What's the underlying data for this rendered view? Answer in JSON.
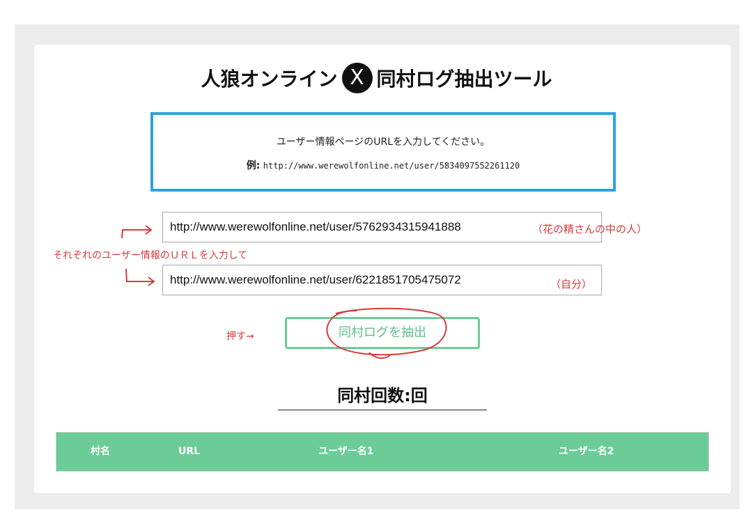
{
  "header": {
    "title_left": "人狼オンライン",
    "title_badge": "X",
    "title_right": "同村ログ抽出ツール"
  },
  "info": {
    "instruction": "ユーザー情報ページのURLを入力してください。",
    "example_label": "例:",
    "example_url": "http://www.werewolfonline.net/user/5834097552261120"
  },
  "form": {
    "url1_value": "http://www.werewolfonline.net/user/5762934315941888",
    "url2_value": "http://www.werewolfonline.net/user/6221851705475072",
    "extract_button_label": "同村ログを抽出"
  },
  "annotations": {
    "note1": "（花の精さんの中の人）",
    "note2": "（自分）",
    "instruction": "それぞれのユーザー情報のＵＲＬを入力して",
    "push": "押す→",
    "color": "#d83a3a"
  },
  "result": {
    "count_label": "同村回数:回"
  },
  "table": {
    "headers": [
      "村名",
      "URL",
      "ユーザー名1",
      "ユーザー名2"
    ],
    "header_bg": "#6bcc97"
  },
  "colors": {
    "info_border": "#2ea2d8",
    "button_border": "#6bcc97",
    "page_bg": "#ececec"
  }
}
